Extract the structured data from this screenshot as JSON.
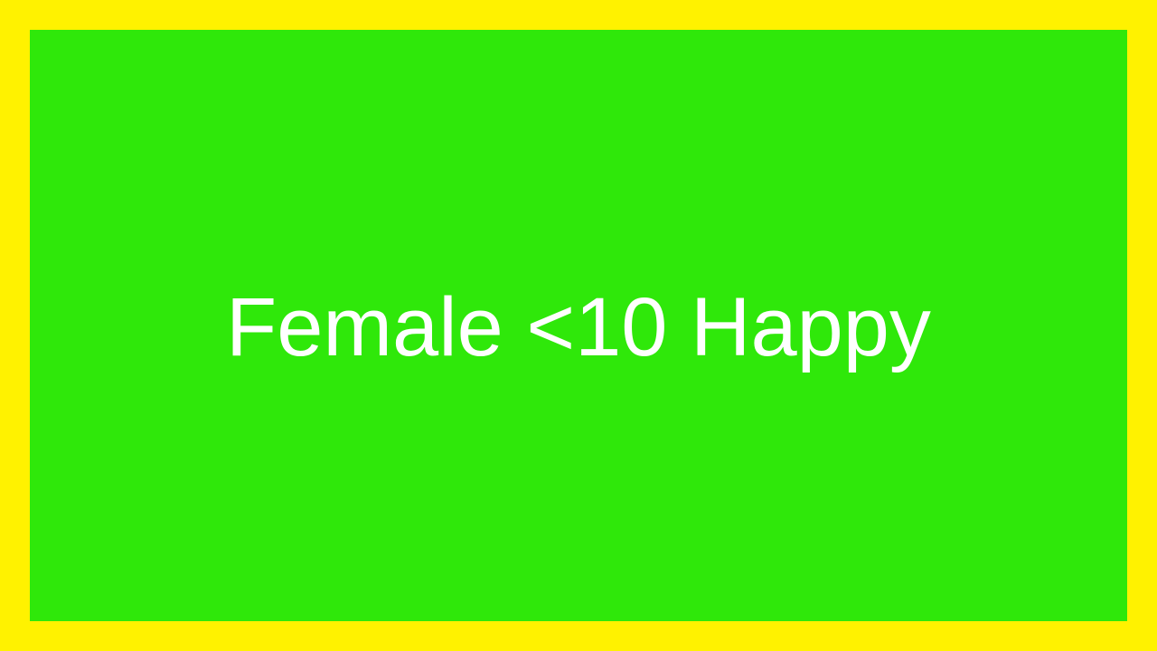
{
  "colors": {
    "border": "#FFF200",
    "panel": "#2FE80A",
    "text": "#FFFFFF"
  },
  "card": {
    "label": "Female <10 Happy"
  }
}
